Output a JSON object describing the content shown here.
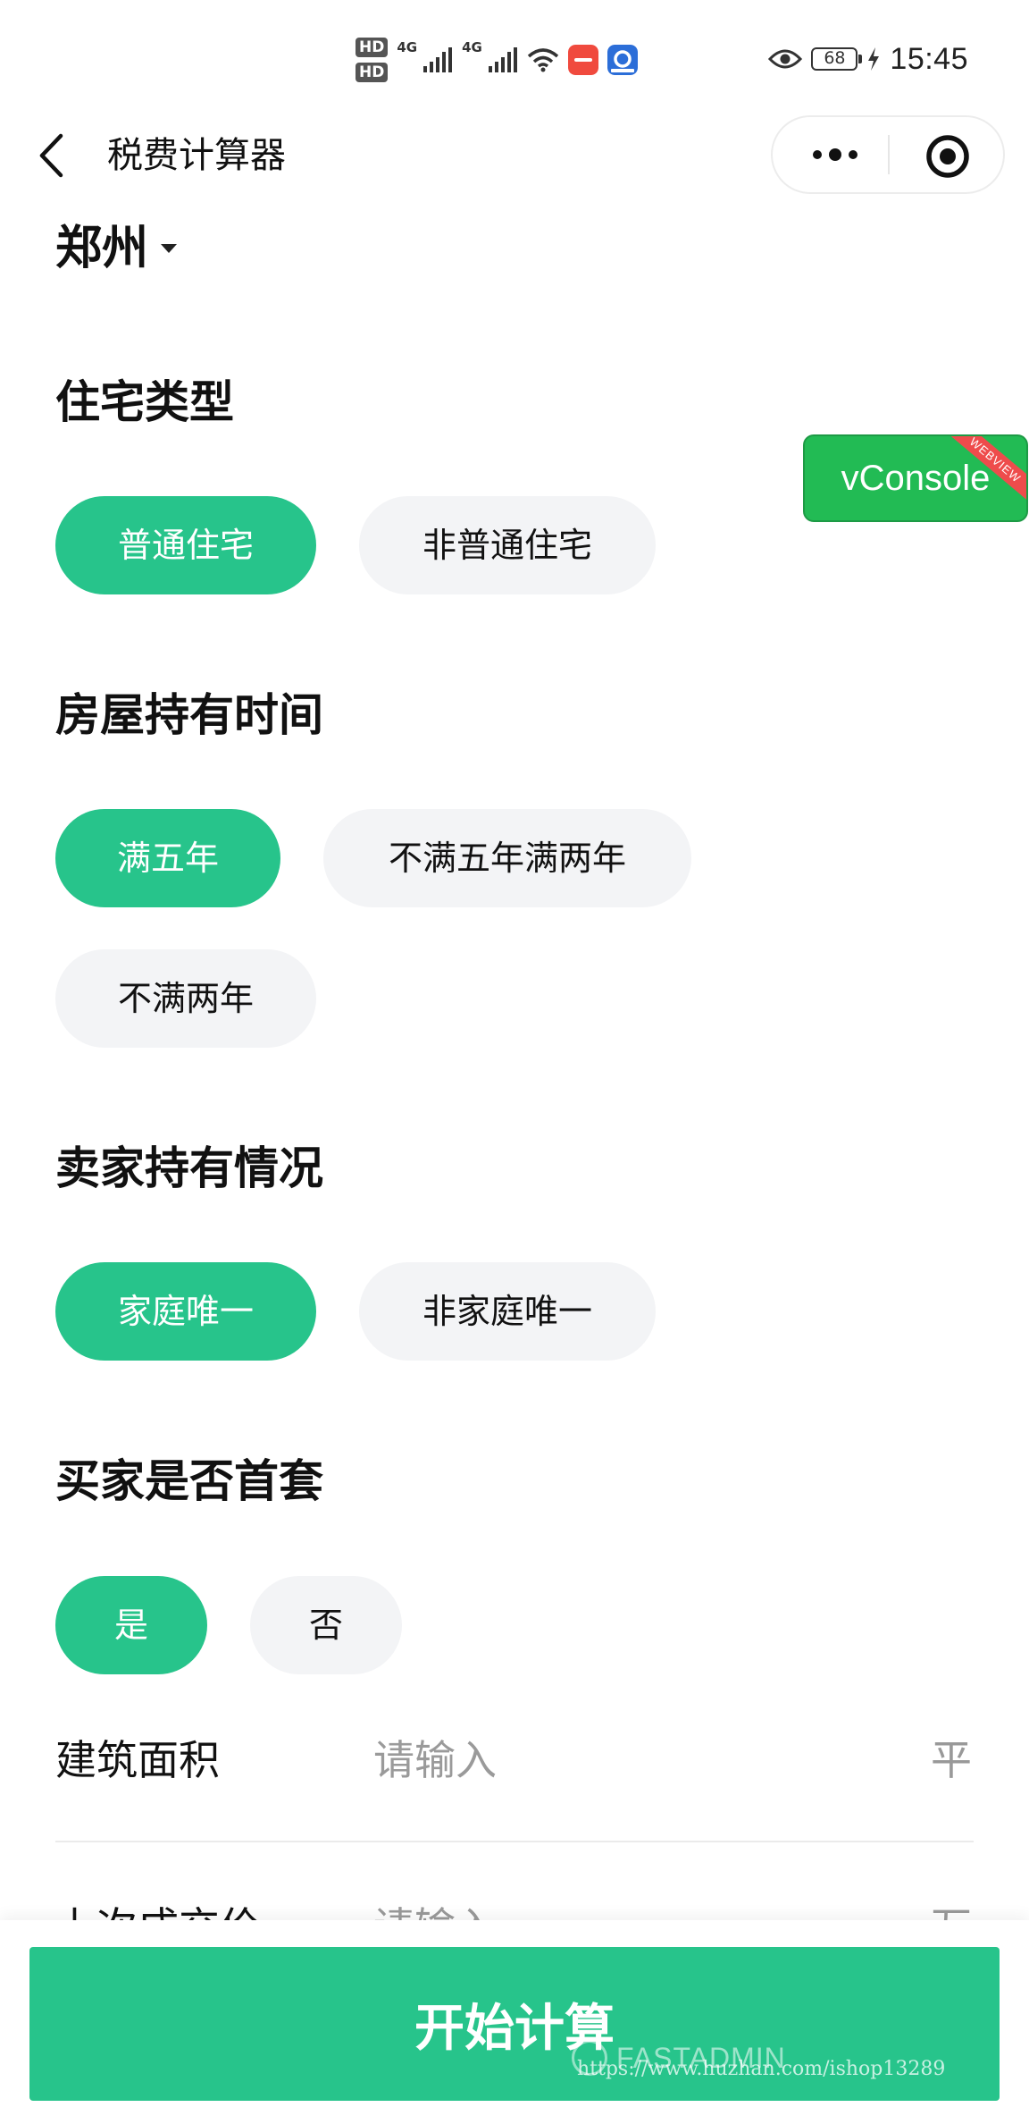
{
  "status_bar": {
    "hd1": "HD",
    "hd2": "HD",
    "net1": "4G",
    "net2": "4G",
    "battery": "68",
    "time": "15:45",
    "icons": [
      "signal-icon",
      "signal-icon",
      "wifi-icon",
      "app-icon",
      "app-icon",
      "eye-icon",
      "battery-icon",
      "charging-icon"
    ]
  },
  "nav": {
    "title": "税费计算器",
    "back_icon": "chevron-left-icon",
    "more_icon": "more-dots-icon",
    "close_icon": "target-circle-icon"
  },
  "city": {
    "name": "郑州",
    "caret_icon": "caret-down-icon"
  },
  "sections": [
    {
      "title": "住宅类型",
      "options": [
        "普通住宅",
        "非普通住宅"
      ],
      "selected": "普通住宅"
    },
    {
      "title": "房屋持有时间",
      "options": [
        "满五年",
        "不满五年满两年",
        "不满两年"
      ],
      "selected": "满五年"
    },
    {
      "title": "卖家持有情况",
      "options": [
        "家庭唯一",
        "非家庭唯一"
      ],
      "selected": "家庭唯一"
    },
    {
      "title": "买家是否首套",
      "options": [
        "是",
        "否"
      ],
      "selected": "是"
    }
  ],
  "form": {
    "area": {
      "label": "建筑面积",
      "placeholder": "请输入",
      "value": "",
      "unit": "平"
    },
    "last_price": {
      "label": "上次成交价",
      "placeholder": "请输入",
      "value": "",
      "unit": "万"
    }
  },
  "vconsole": {
    "label": "vConsole",
    "ribbon": "WEBVIEW"
  },
  "button": {
    "label": "开始计算"
  },
  "watermark": {
    "brand": "FASTADMIN",
    "url": "https://www.huzhan.com/ishop13289"
  },
  "colors": {
    "accent": "#27c48b",
    "inactive_bg": "#f3f4f6",
    "vconsole": "#22bb54",
    "ribbon": "#ee4c4c"
  }
}
